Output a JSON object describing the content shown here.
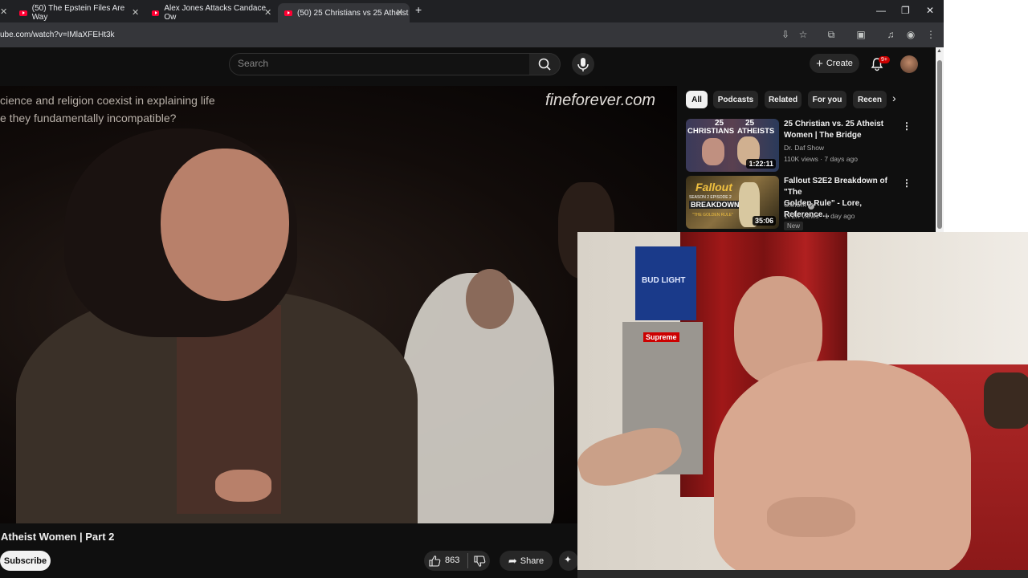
{
  "browser": {
    "tabs": [
      {
        "title": "(50) The Epstein Files Are Way"
      },
      {
        "title": "Alex Jones Attacks Candace Ow"
      },
      {
        "title": "(50) 25 Christians vs 25 Atheist"
      }
    ],
    "url": "ube.com/watch?v=IMlaXFEHt3k"
  },
  "youtube": {
    "search_placeholder": "Search",
    "create_label": "Create",
    "notifications": "9+",
    "video": {
      "caption_line1": "cience and religion coexist in explaining life",
      "caption_line2": "e they fundamentally incompatible?",
      "watermark": "fineforever.com",
      "title": "Atheist Women | Part 2",
      "subscribe_label": "Subscribe",
      "likes": "863",
      "share_label": "Share"
    },
    "chips": [
      "All",
      "Podcasts",
      "Related",
      "For you",
      "Recen"
    ],
    "related": [
      {
        "title_line1": "25 Christian vs. 25 Atheist",
        "title_line2": "Women | The Bridge",
        "channel": "Dr. Daf Show",
        "meta": "110K views · 7 days ago",
        "duration": "1:22:11",
        "thumb_text_left": "CHRISTIANS",
        "thumb_text_right": "ATHEISTS",
        "thumb_num": "25"
      },
      {
        "title_line1": "Fallout S2E2 Breakdown of \"The",
        "title_line2": "Golden Rule\" - Lore, Reference...",
        "channel": "Oxhorn",
        "meta": "172K views · 1 day ago",
        "duration": "35:06",
        "badge": "New",
        "thumb_text_top": "Fallout",
        "thumb_text_mid": "BREAKDOWN",
        "thumb_text_sub": "SEASON 2 EPISODE 2",
        "thumb_text_bottom": "\"THE GOLDEN RULE\""
      }
    ]
  },
  "webcam": {
    "supreme_sticker": "Supreme",
    "box_label": "BUD LIGHT"
  }
}
